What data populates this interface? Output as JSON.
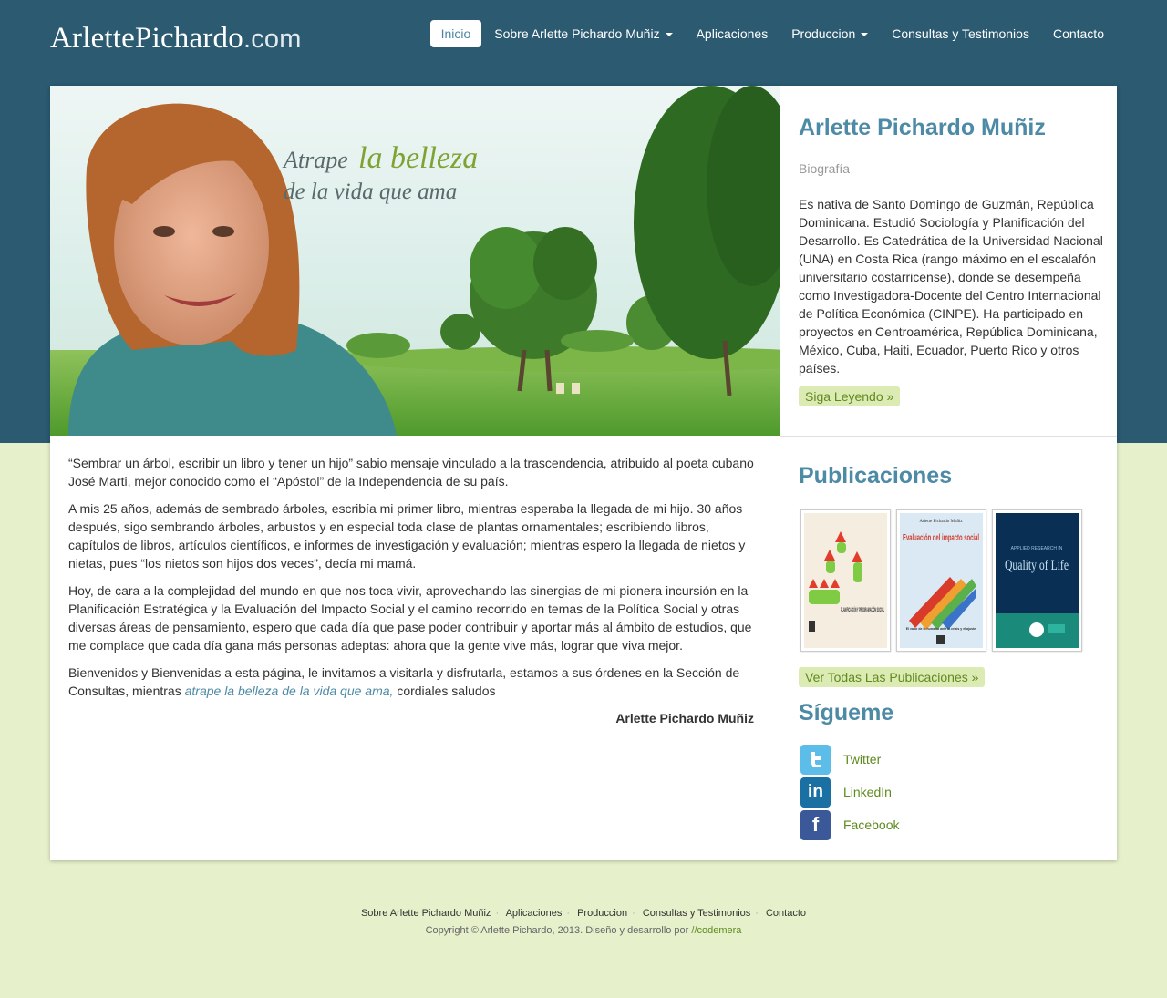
{
  "header": {
    "logo_main": "ArlettePichardo",
    "logo_suffix": ".com",
    "nav": [
      {
        "label": "Inicio",
        "active": true
      },
      {
        "label": "Sobre Arlette Pichardo Muñiz",
        "dropdown": true
      },
      {
        "label": "Aplicaciones"
      },
      {
        "label": "Produccion",
        "dropdown": true
      },
      {
        "label": "Consultas y Testimonios"
      },
      {
        "label": "Contacto"
      }
    ]
  },
  "hero": {
    "line1_a": "Atrape",
    "line1_b": "la belleza",
    "line2": "de la vida que ama"
  },
  "bio": {
    "title": "Arlette Pichardo Muñiz",
    "subtitle": "Biografía",
    "text": "Es nativa de Santo Domingo de Guzmán, República Dominicana. Estudió Sociología y Planificación del Desarrollo. Es Catedrática de la Universidad Nacional (UNA) en Costa Rica (rango máximo en el escalafón universitario costarricense), donde se desempeña como Investigadora-Docente del Centro Internacional de Política Económica (CINPE). Ha participado en proyectos en Centroamérica, República Dominicana, México, Cuba, Haiti, Ecuador, Puerto Rico y otros países.",
    "button": "Siga Leyendo »"
  },
  "main": {
    "p1": "“Sembrar un árbol, escribir un libro y tener un hijo” sabio mensaje vinculado a la trascendencia, atribuido al poeta cubano José Marti, mejor conocido como el “Apóstol” de la Independencia de su país.",
    "p2": "A mis 25 años, además de sembrado árboles, escribía mi primer libro, mientras esperaba la llegada de mi hijo. 30 años después, sigo sembrando árboles, arbustos y en especial toda clase de plantas ornamentales; escribiendo libros, capítulos de libros, artículos científicos, e informes de investigación y evaluación; mientras espero la llegada de nietos y nietas, pues “los nietos son hijos dos veces”, decía mi mamá.",
    "p3": "Hoy, de cara a la complejidad del mundo en que nos toca vivir, aprovechando las sinergias de mi pionera incursión en la Planificación Estratégica y la Evaluación del Impacto Social y el camino recorrido en temas de la Política Social y otras diversas áreas de pensamiento, espero que cada día que pase poder contribuir y aportar más al ámbito de estudios, que me complace que cada día gana más personas adeptas: ahora que la gente vive más, lograr que viva mejor.",
    "p4_a": "Bienvenidos y Bienvenidas a esta página, le invitamos a visitarla y disfrutarla, estamos a sus órdenes en la Sección de Consultas, mientras ",
    "p4_link": "atrape la belleza de la vida que ama,",
    "p4_b": " cordiales saludos",
    "signature": "Arlette Pichardo Muñiz"
  },
  "publications": {
    "title": "Publicaciones",
    "books": [
      {
        "title": "PLANIFICACIÓN Y PROGRAMACIÓN SOCIAL"
      },
      {
        "author": "Arlette Pichardo Muñiz",
        "title": "Evaluación del impacto social",
        "tagline": "El valor de lo humano ante la crisis y el ajuste"
      },
      {
        "series": "APPLIED RESEARCH IN",
        "title": "Quality of Life"
      }
    ],
    "button": "Ver Todas Las Publicaciones »"
  },
  "follow": {
    "title": "Sígueme",
    "items": [
      {
        "label": "Twitter",
        "icon": "twitter-icon",
        "color": "#4fb3e3"
      },
      {
        "label": "LinkedIn",
        "icon": "linkedin-icon",
        "color": "#1a6fa3"
      },
      {
        "label": "Facebook",
        "icon": "facebook-icon",
        "color": "#3b5998"
      }
    ]
  },
  "footer": {
    "links": [
      "Sobre Arlette Pichardo Muñiz",
      "Aplicaciones",
      "Produccion",
      "Consultas y Testimonios",
      "Contacto"
    ],
    "copyright": "Copyright © Arlette Pichardo, 2013. Diseño y desarrollo por ",
    "credit": "//codemera"
  }
}
